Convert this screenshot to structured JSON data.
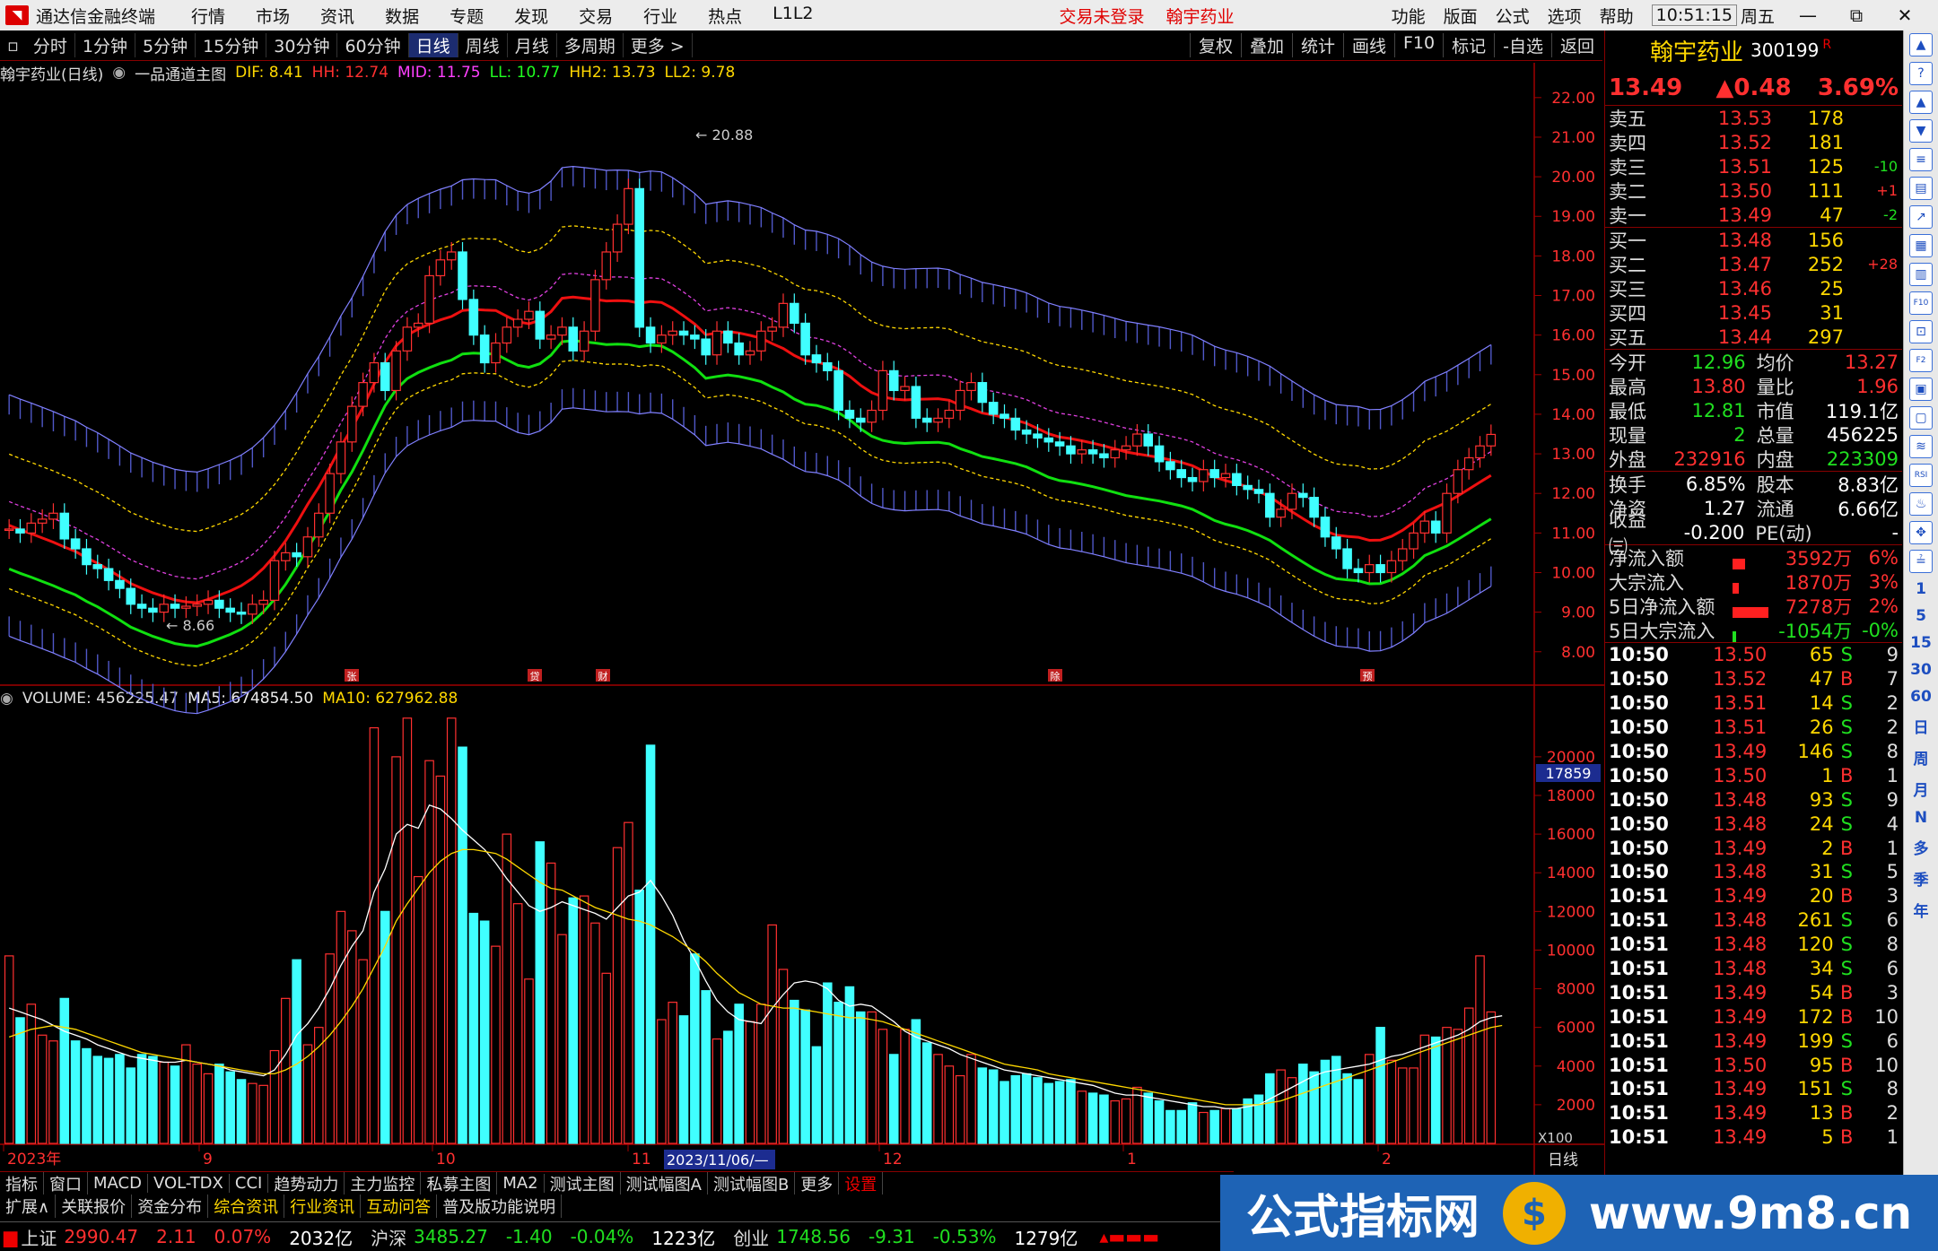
{
  "app": {
    "title": "通达信金融终端",
    "menu": [
      "行情",
      "市场",
      "资讯",
      "数据",
      "专题",
      "发现",
      "交易",
      "行业",
      "热点",
      "L1L2"
    ],
    "warn": "交易未登录",
    "stock_name": "翰宇药业",
    "rmenu": [
      "功能",
      "版面",
      "公式",
      "选项",
      "帮助"
    ],
    "time": "10:51:15",
    "weekday": "周五",
    "win_buttons": [
      "✕",
      "⧉",
      "—"
    ]
  },
  "toolbar": {
    "periods": [
      "分时",
      "1分钟",
      "5分钟",
      "15分钟",
      "30分钟",
      "60分钟",
      "日线",
      "周线",
      "月线",
      "多周期",
      "更多 >"
    ],
    "active": "日线",
    "right": [
      "复权",
      "叠加",
      "统计",
      "画线",
      "F10",
      "标记",
      "-自选",
      "返回"
    ]
  },
  "indicator_line": {
    "name": "翰宇药业(日线)",
    "formula": "一品通道主图",
    "dif": "DIF: 8.41",
    "hh": "HH: 12.74",
    "mid": "MID: 11.75",
    "ll": "LL: 10.77",
    "hh2": "HH2: 13.73",
    "ll2": "LL2: 9.78"
  },
  "volume_line": {
    "vol": "VOLUME: 456225.47",
    "ma5": "MA5: 674854.50",
    "ma10": "MA10: 627962.88"
  },
  "chart_data": {
    "type": "candlestick",
    "y_ticks": [
      "22.00",
      "21.00",
      "20.00",
      "19.00",
      "18.00",
      "17.00",
      "16.00",
      "15.00",
      "14.00",
      "13.00",
      "12.00",
      "11.00",
      "10.00",
      "9.00",
      "8.00"
    ],
    "ylim": [
      7.7,
      22.2
    ],
    "high_label": "20.88",
    "low_label": "8.66",
    "event_marks": [
      "张",
      "贷",
      "财",
      "除",
      "预"
    ],
    "vol_ticks": [
      "20000",
      "18000",
      "16000",
      "14000",
      "12000",
      "10000",
      "8000",
      "6000",
      "4000",
      "2000"
    ],
    "vol_unit": "X100",
    "vol_cursor": "17859",
    "x_labels": [
      "2023年",
      "9",
      "10",
      "11",
      "12",
      "1",
      "2"
    ],
    "cursor_date": "2023/11/06/—",
    "x_right": "日线",
    "closes": [
      11.1,
      11.0,
      11.25,
      11.35,
      11.5,
      10.85,
      10.6,
      10.2,
      10.1,
      9.8,
      9.6,
      9.2,
      9.1,
      9.0,
      9.2,
      9.1,
      9.15,
      9.2,
      9.3,
      9.1,
      9.0,
      8.95,
      9.2,
      9.3,
      10.3,
      10.5,
      10.4,
      10.9,
      11.5,
      12.5,
      13.3,
      14.2,
      14.8,
      15.3,
      14.6,
      15.6,
      16.2,
      16.3,
      17.5,
      17.9,
      18.1,
      16.9,
      16.0,
      15.3,
      15.8,
      16.2,
      16.4,
      16.6,
      15.9,
      16.0,
      16.2,
      15.6,
      16.1,
      17.4,
      18.1,
      18.8,
      19.7,
      16.2,
      15.8,
      16.0,
      16.1,
      16.0,
      15.9,
      15.5,
      16.1,
      15.8,
      15.5,
      15.6,
      16.1,
      16.2,
      16.8,
      16.3,
      15.5,
      15.3,
      15.1,
      14.1,
      13.9,
      13.8,
      14.1,
      15.1,
      14.6,
      14.7,
      13.9,
      13.8,
      13.9,
      14.1,
      14.6,
      14.8,
      14.3,
      14.0,
      13.9,
      13.6,
      13.5,
      13.4,
      13.3,
      13.2,
      13.0,
      13.1,
      13.0,
      12.9,
      13.1,
      13.2,
      13.5,
      13.2,
      12.8,
      12.6,
      12.4,
      12.3,
      12.6,
      12.4,
      12.5,
      12.2,
      12.1,
      12.0,
      11.4,
      11.6,
      12.0,
      11.9,
      11.4,
      10.9,
      10.6,
      10.1,
      10.0,
      10.2,
      10.0,
      10.3,
      10.6,
      11.0,
      11.3,
      11.0,
      12.0,
      12.6,
      12.9,
      13.2,
      13.49
    ],
    "volumes": [
      9700,
      6500,
      7200,
      5600,
      5300,
      7500,
      5300,
      4900,
      4500,
      4400,
      4600,
      3900,
      4600,
      4500,
      4200,
      4000,
      5100,
      4100,
      3600,
      4100,
      3700,
      3300,
      3100,
      3000,
      4800,
      7500,
      9500,
      5100,
      6000,
      9800,
      12000,
      11000,
      9500,
      21500,
      12000,
      20000,
      22000,
      13800,
      19800,
      19000,
      22000,
      20500,
      11900,
      11500,
      10200,
      16000,
      12400,
      8500,
      15600,
      14500,
      10800,
      12700,
      12800,
      11400,
      8800,
      15300,
      16600,
      13100,
      20600,
      6400,
      7300,
      6600,
      9800,
      7900,
      5400,
      5800,
      7200,
      6300,
      7200,
      11300,
      9000,
      7400,
      6900,
      5000,
      8300,
      7300,
      8100,
      6800,
      6800,
      5900,
      4600,
      5900,
      6400,
      5200,
      4600,
      4000,
      3500,
      4600,
      3900,
      3800,
      3200,
      3500,
      3600,
      3400,
      3100,
      3200,
      3300,
      2700,
      2600,
      2500,
      2200,
      2300,
      2900,
      2600,
      2200,
      1700,
      1700,
      2100,
      1600,
      1700,
      1800,
      1800,
      2300,
      2500,
      3600,
      3800,
      3400,
      4100,
      3700,
      4300,
      4500,
      3600,
      3300,
      4600,
      6000,
      4300,
      3900,
      3900,
      5600,
      5500,
      6000,
      5900,
      7000,
      9700,
      6800,
      4500
    ],
    "ma5": [
      7000,
      6800,
      6600,
      6400,
      6100,
      5800,
      5600,
      5400,
      5100,
      4900,
      4700,
      4500,
      4400,
      4300,
      4200,
      4200,
      4300,
      4200,
      4100,
      4000,
      3800,
      3700,
      3600,
      3500,
      3800,
      4600,
      5600,
      6200,
      7000,
      8000,
      9200,
      10200,
      11000,
      13000,
      14200,
      16000,
      16500,
      16300,
      17500,
      17300,
      16800,
      16200,
      15700,
      15200,
      14500,
      13700,
      13000,
      12300,
      12000,
      12200,
      12500,
      12300,
      12100,
      11900,
      11600,
      12200,
      12800,
      13000,
      13600,
      12800,
      11800,
      10500,
      9500,
      8400,
      7400,
      6800,
      6400,
      6300,
      6200,
      7000,
      7700,
      8300,
      8400,
      8300,
      8000,
      7400,
      7100,
      7200,
      7100,
      6700,
      6300,
      5800,
      5500,
      5300,
      5100,
      4900,
      4600,
      4400,
      4200,
      4000,
      3800,
      3700,
      3600,
      3500,
      3400,
      3300,
      3200,
      3100,
      3000,
      2800,
      2600,
      2500,
      2500,
      2400,
      2300,
      2200,
      2100,
      2000,
      1900,
      1900,
      1800,
      1800,
      1900,
      2000,
      2300,
      2600,
      2900,
      3200,
      3500,
      3700,
      3800,
      3900,
      4000,
      4100,
      4300,
      4500,
      4600,
      4800,
      5000,
      5200,
      5400,
      5600,
      5900,
      6300,
      6500,
      6600
    ],
    "ma10": [
      5500,
      5700,
      5900,
      6000,
      6100,
      6000,
      5900,
      5700,
      5500,
      5300,
      5100,
      4900,
      4700,
      4600,
      4500,
      4400,
      4300,
      4200,
      4100,
      4000,
      3900,
      3800,
      3700,
      3600,
      3600,
      3800,
      4100,
      4500,
      5000,
      5600,
      6300,
      7100,
      8000,
      9100,
      10200,
      11500,
      12400,
      13200,
      14000,
      14600,
      15000,
      15200,
      15200,
      15100,
      15000,
      14700,
      14300,
      13900,
      13500,
      13200,
      13100,
      12800,
      12500,
      12200,
      12000,
      11800,
      11600,
      11500,
      11300,
      11000,
      10700,
      10300,
      9900,
      9400,
      8800,
      8300,
      7800,
      7500,
      7200,
      7100,
      7000,
      7000,
      6900,
      6800,
      6700,
      6600,
      6500,
      6500,
      6400,
      6300,
      6100,
      5900,
      5700,
      5500,
      5300,
      5100,
      4900,
      4700,
      4500,
      4300,
      4100,
      4000,
      3900,
      3800,
      3600,
      3500,
      3400,
      3300,
      3200,
      3100,
      3000,
      2900,
      2800,
      2700,
      2600,
      2500,
      2400,
      2300,
      2200,
      2100,
      2000,
      2000,
      2000,
      2000,
      2100,
      2200,
      2400,
      2600,
      2800,
      3000,
      3200,
      3400,
      3600,
      3800,
      4000,
      4200,
      4400,
      4600,
      4800,
      5000,
      5200,
      5400,
      5600,
      5800,
      6000,
      6100
    ]
  },
  "panel": {
    "name": "翰宇药业",
    "code": "300199",
    "r_mark": "R",
    "price": "13.49",
    "change": "▲0.48",
    "pct": "3.69%",
    "sells": [
      {
        "lab": "卖五",
        "p": "13.53",
        "v": "178",
        "c": ""
      },
      {
        "lab": "卖四",
        "p": "13.52",
        "v": "181",
        "c": ""
      },
      {
        "lab": "卖三",
        "p": "13.51",
        "v": "125",
        "c": "-10"
      },
      {
        "lab": "卖二",
        "p": "13.50",
        "v": "111",
        "c": "+1"
      },
      {
        "lab": "卖一",
        "p": "13.49",
        "v": "47",
        "c": "-2"
      }
    ],
    "buys": [
      {
        "lab": "买一",
        "p": "13.48",
        "v": "156",
        "c": ""
      },
      {
        "lab": "买二",
        "p": "13.47",
        "v": "252",
        "c": "+28"
      },
      {
        "lab": "买三",
        "p": "13.46",
        "v": "25",
        "c": ""
      },
      {
        "lab": "买四",
        "p": "13.45",
        "v": "31",
        "c": ""
      },
      {
        "lab": "买五",
        "p": "13.44",
        "v": "297",
        "c": ""
      }
    ],
    "stats1": [
      {
        "l1": "今开",
        "v1": "12.96",
        "l2": "均价",
        "v2": "13.27"
      },
      {
        "l1": "最高",
        "v1": "13.80",
        "l2": "量比",
        "v2": "1.96"
      },
      {
        "l1": "最低",
        "v1": "12.81",
        "l2": "市值",
        "v2": "119.1亿"
      },
      {
        "l1": "现量",
        "v1": "2",
        "l2": "总量",
        "v2": "456225"
      },
      {
        "l1": "外盘",
        "v1": "232916",
        "l2": "内盘",
        "v2": "223309"
      }
    ],
    "stats2": [
      {
        "l1": "换手",
        "v1": "6.85%",
        "l2": "股本",
        "v2": "8.83亿"
      },
      {
        "l1": "净资",
        "v1": "1.27",
        "l2": "流通",
        "v2": "6.66亿"
      },
      {
        "l1": "收益㈢",
        "v1": "-0.200",
        "l2": "PE(动)",
        "v2": "-"
      }
    ],
    "flows": [
      {
        "lab": "净流入额",
        "bar": 0.35,
        "v": "3592万",
        "p": "6%"
      },
      {
        "lab": "大宗流入",
        "bar": 0.18,
        "v": "1870万",
        "p": "3%"
      },
      {
        "lab": "5日净流入额",
        "bar": 1.0,
        "v": "7278万",
        "p": "2%"
      },
      {
        "lab": "5日大宗流入",
        "bar": -0.1,
        "v": "-1054万",
        "p": "-0%"
      }
    ],
    "ticks": [
      [
        "10:50",
        "13.50",
        "65",
        "S",
        "9"
      ],
      [
        "10:50",
        "13.52",
        "47",
        "B",
        "7"
      ],
      [
        "10:50",
        "13.51",
        "14",
        "S",
        "2"
      ],
      [
        "10:50",
        "13.51",
        "26",
        "S",
        "2"
      ],
      [
        "10:50",
        "13.49",
        "146",
        "S",
        "8"
      ],
      [
        "10:50",
        "13.50",
        "1",
        "B",
        "1"
      ],
      [
        "10:50",
        "13.48",
        "93",
        "S",
        "9"
      ],
      [
        "10:50",
        "13.48",
        "24",
        "S",
        "4"
      ],
      [
        "10:50",
        "13.49",
        "2",
        "B",
        "1"
      ],
      [
        "10:50",
        "13.48",
        "31",
        "S",
        "5"
      ],
      [
        "10:51",
        "13.49",
        "20",
        "B",
        "3"
      ],
      [
        "10:51",
        "13.48",
        "261",
        "S",
        "6"
      ],
      [
        "10:51",
        "13.48",
        "120",
        "S",
        "8"
      ],
      [
        "10:51",
        "13.48",
        "34",
        "S",
        "6"
      ],
      [
        "10:51",
        "13.49",
        "54",
        "B",
        "3"
      ],
      [
        "10:51",
        "13.49",
        "172",
        "B",
        "10"
      ],
      [
        "10:51",
        "13.49",
        "199",
        "S",
        "6"
      ],
      [
        "10:51",
        "13.50",
        "95",
        "B",
        "10"
      ],
      [
        "10:51",
        "13.49",
        "151",
        "S",
        "8"
      ],
      [
        "10:51",
        "13.49",
        "13",
        "B",
        "2"
      ],
      [
        "10:51",
        "13.49",
        "5",
        "B",
        "1"
      ]
    ]
  },
  "side": {
    "icons": [
      "▲",
      "?",
      "▲",
      "▼",
      "≡",
      "▤",
      "↗",
      "▦",
      "▥",
      "F10",
      "⊡",
      "F2",
      "▣",
      "▢",
      "≋",
      "RSI",
      "♨",
      "✥",
      "≟"
    ],
    "texts": [
      "1",
      "5",
      "15",
      "30",
      "60",
      "日",
      "周",
      "月",
      "N",
      "多",
      "季",
      "年"
    ]
  },
  "bottom1": [
    "指标",
    "窗口",
    "MACD",
    "VOL-TDX",
    "CCI",
    "趋势动力",
    "主力监控",
    "私募主图",
    "MA2",
    "测试主图",
    "测试幅图A",
    "测试幅图B",
    "更多",
    "设置"
  ],
  "bottom2": [
    "扩展∧",
    "关联报价",
    "资金分布",
    "综合资讯",
    "行业资讯",
    "互动问答",
    "普及版功能说明"
  ],
  "status": {
    "idx1": "上证",
    "v1": "2990.47",
    "c1": "2.11",
    "p1": "0.07%",
    "a1": "2032亿",
    "idx2": "沪深",
    "v2": "3485.27",
    "c2": "-1.40",
    "p2": "-0.04%",
    "a2": "1223亿",
    "idx3": "创业",
    "v3": "1748.56",
    "c3": "-9.31",
    "p3": "-0.53%",
    "a3": "1279亿"
  },
  "watermark": {
    "text": "公式指标网",
    "url": "www.9m8.cn",
    "icon": "$"
  }
}
